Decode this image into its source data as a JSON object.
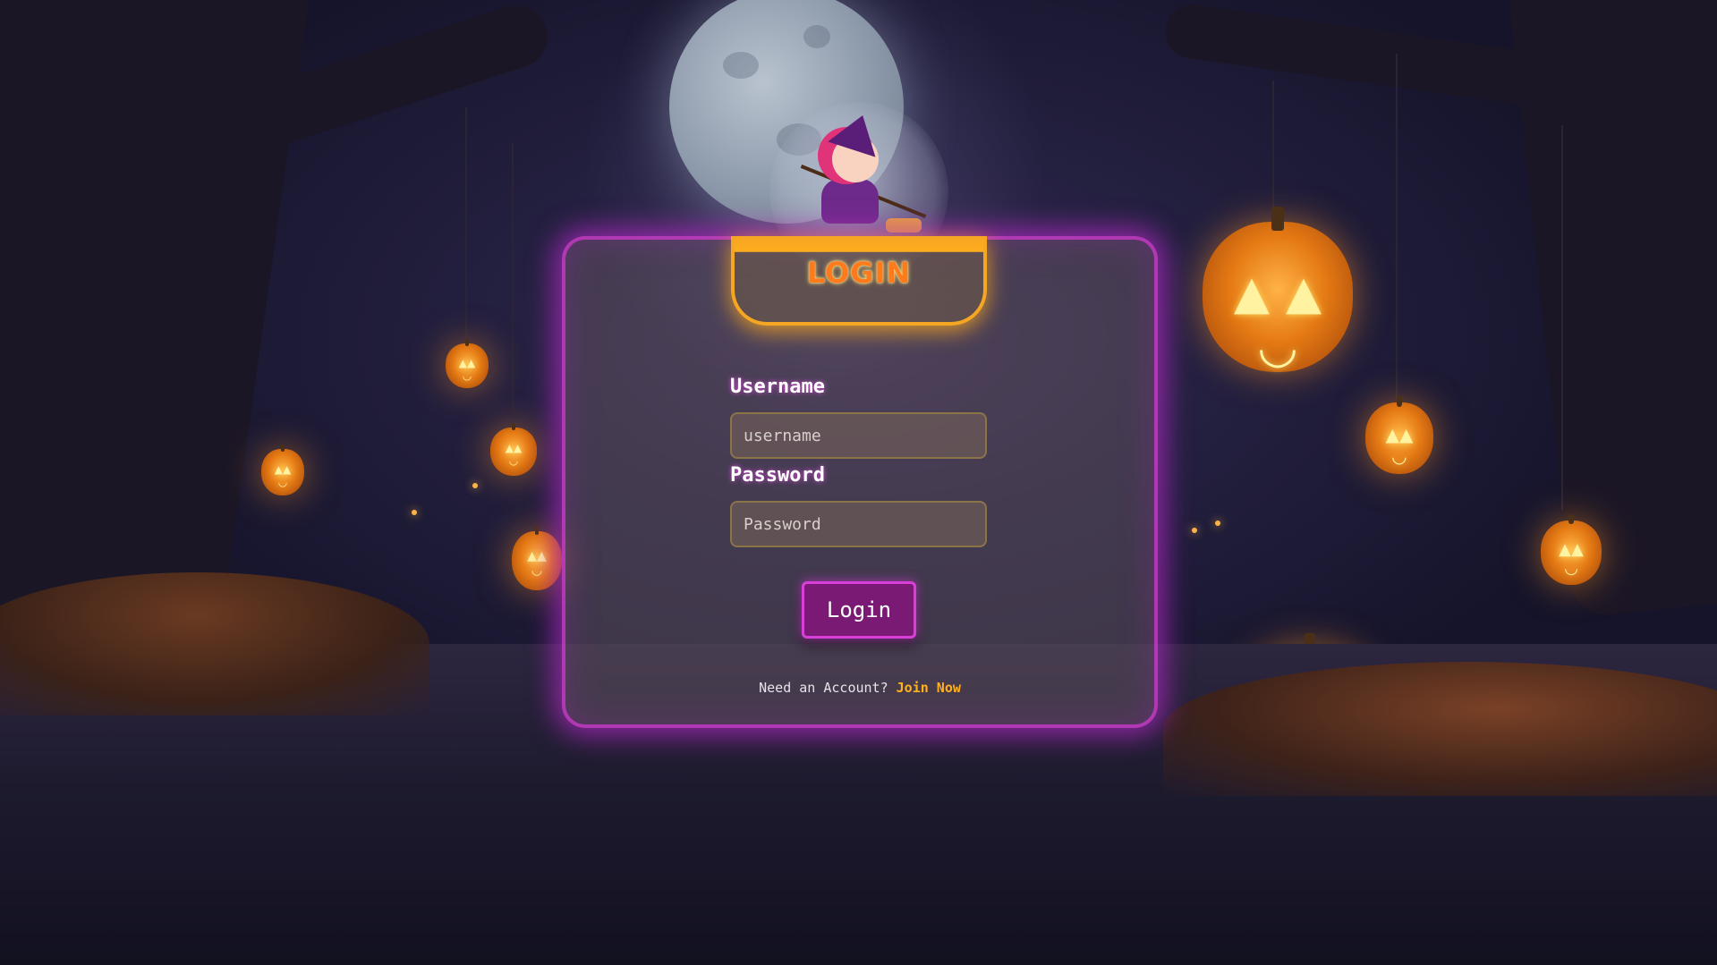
{
  "card": {
    "title": "LOGIN",
    "username_label": "Username",
    "username_placeholder": "username",
    "password_label": "Password",
    "password_placeholder": "Password",
    "login_button": "Login",
    "account_prompt": "Need an Account?",
    "join_link": "Join Now"
  },
  "theme": {
    "card_glow": "#d838d8",
    "title_accent": "#f5a623",
    "link_color": "#ffb020",
    "button_bg": "#7a1a74"
  },
  "background": {
    "icons": [
      "moon",
      "witch-on-broom",
      "jack-o-lantern",
      "tree",
      "lake"
    ]
  }
}
